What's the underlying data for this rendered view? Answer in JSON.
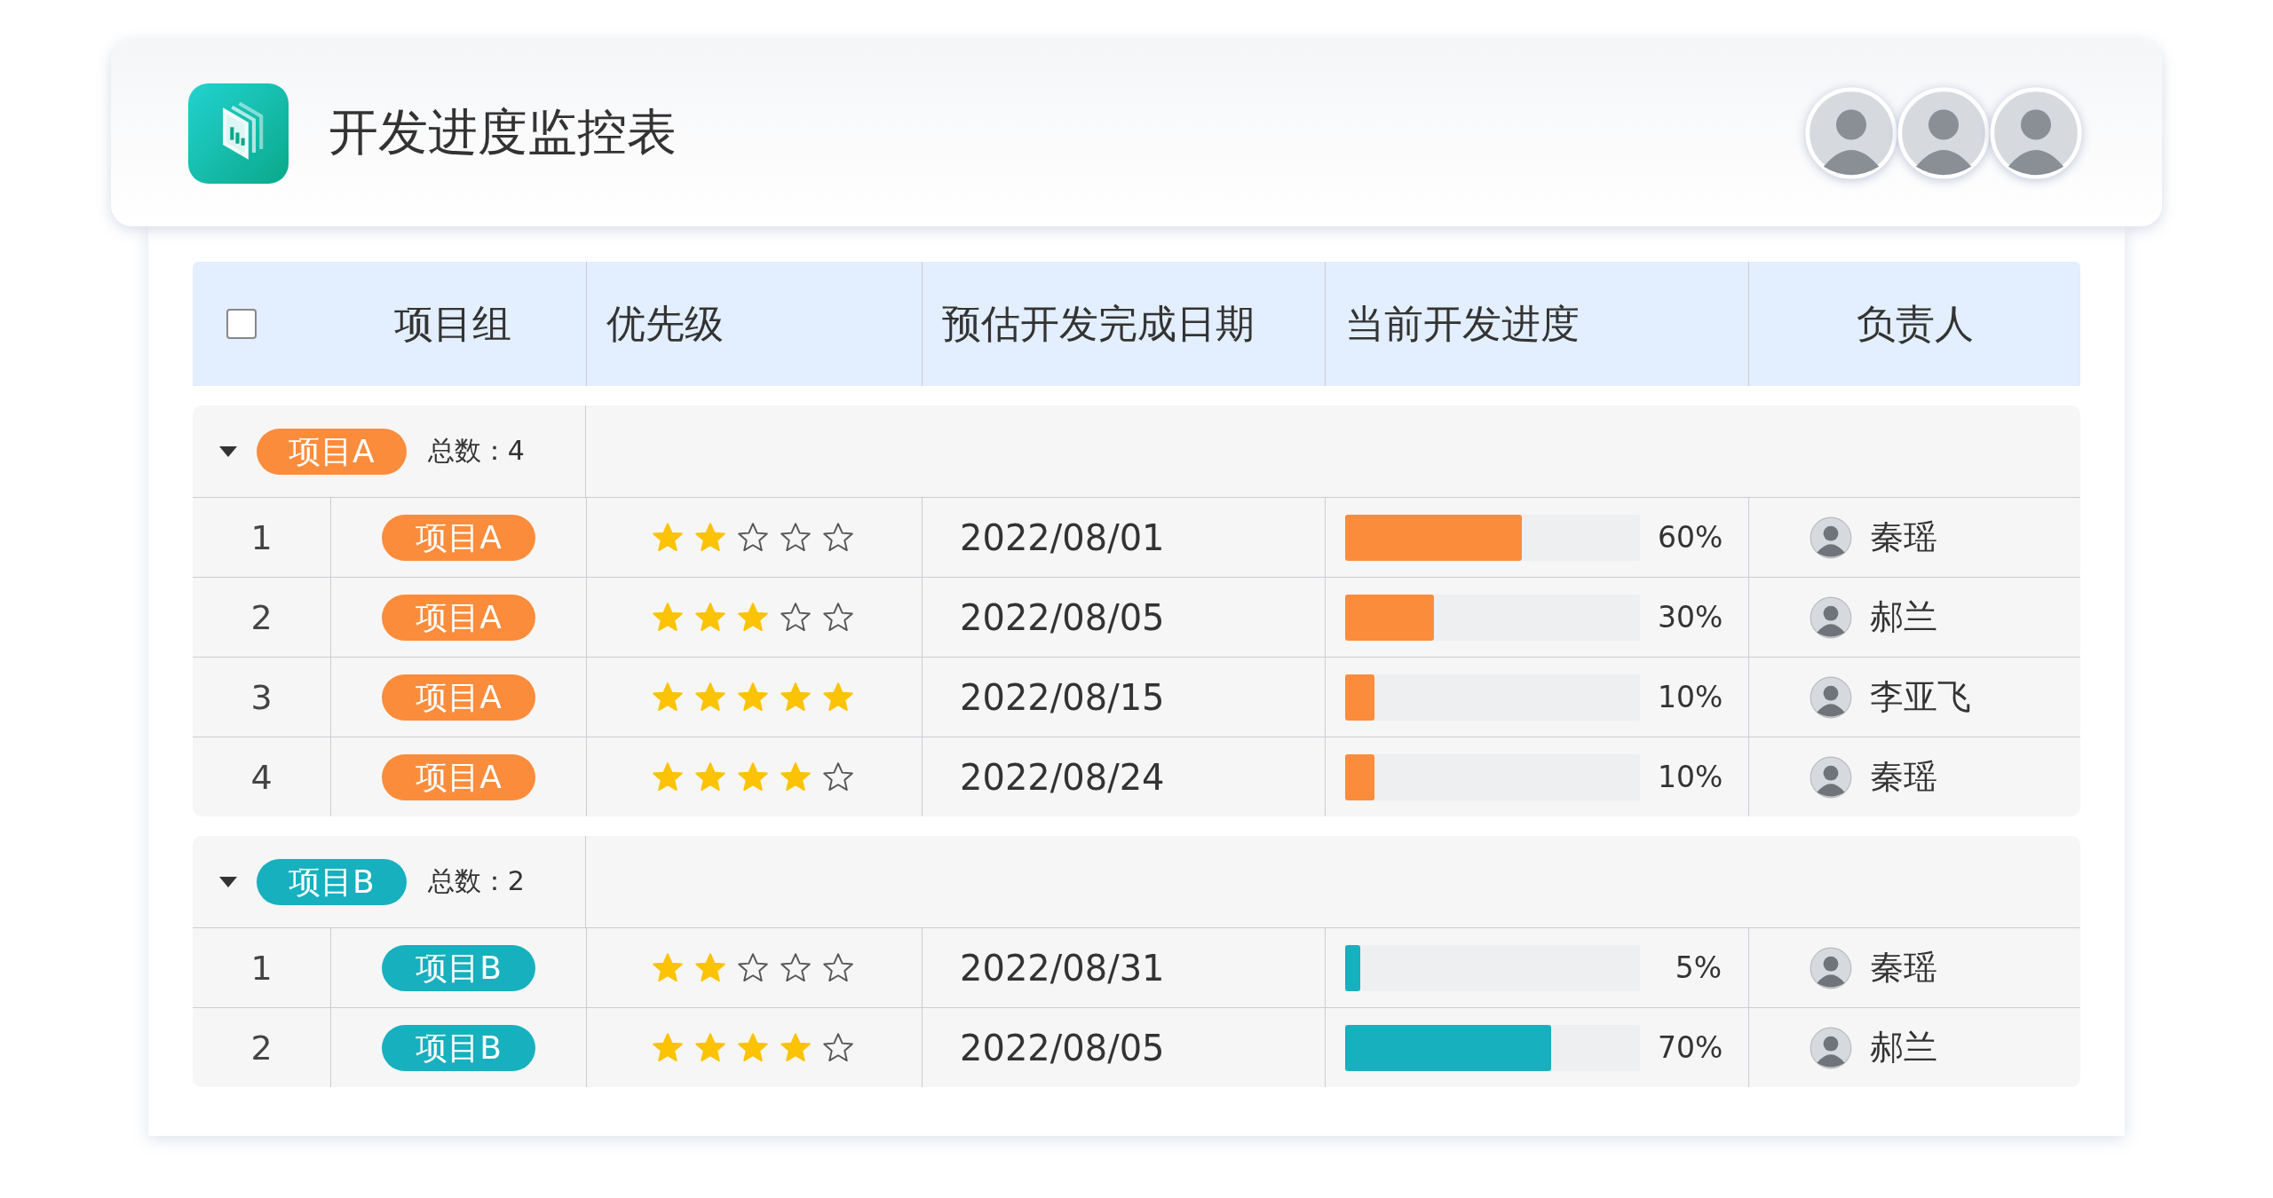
{
  "app": {
    "title": "开发进度监控表"
  },
  "table": {
    "select_all": {
      "checked": false
    },
    "columns": [
      "项目组",
      "优先级",
      "预估开发完成日期",
      "当前开发进度",
      "负责人"
    ],
    "groups": [
      {
        "tag": "项目A",
        "color": "#fb8c3c",
        "count_label": "总数：",
        "count": "4",
        "expanded": true,
        "rows": [
          {
            "index": "1",
            "tag": "项目A",
            "stars": 2,
            "date": "2022/08/01",
            "level": 0.6,
            "percent": "60%",
            "owner": "秦瑶"
          },
          {
            "index": "2",
            "tag": "项目A",
            "stars": 3,
            "date": "2022/08/05",
            "level": 0.3,
            "percent": "30%",
            "owner": "郝兰"
          },
          {
            "index": "3",
            "tag": "项目A",
            "stars": 5,
            "date": "2022/08/15",
            "level": 0.1,
            "percent": "10%",
            "owner": "李亚飞"
          },
          {
            "index": "4",
            "tag": "项目A",
            "stars": 4,
            "date": "2022/08/24",
            "level": 0.1,
            "percent": "10%",
            "owner": "秦瑶"
          }
        ]
      },
      {
        "tag": "项目B",
        "color": "#17b0bf",
        "count_label": "总数：",
        "count": "2",
        "expanded": true,
        "rows": [
          {
            "index": "1",
            "tag": "项目B",
            "stars": 2,
            "date": "2022/08/31",
            "level": 0.05,
            "percent": "5%",
            "owner": "秦瑶"
          },
          {
            "index": "2",
            "tag": "项目B",
            "stars": 4,
            "date": "2022/08/05",
            "level": 0.7,
            "percent": "70%",
            "owner": "郝兰"
          }
        ]
      }
    ]
  }
}
